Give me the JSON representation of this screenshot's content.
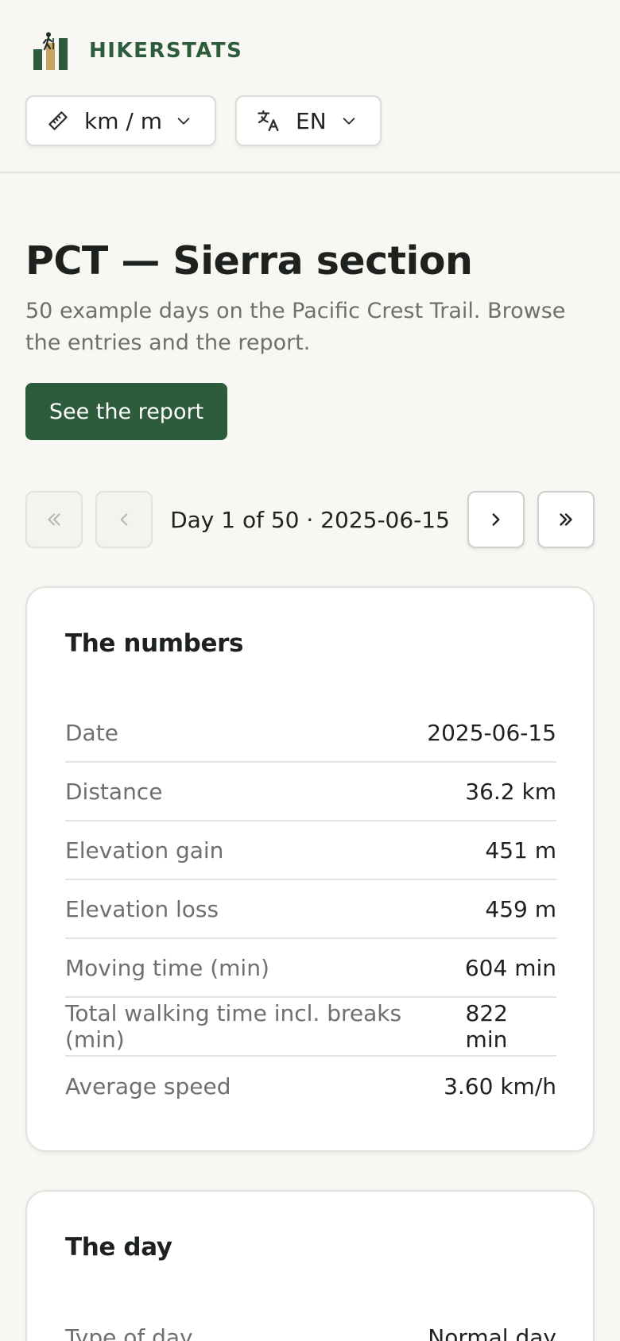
{
  "header": {
    "brand_name": "HIKERSTATS",
    "units_select": {
      "icon": "ruler-icon",
      "value": "km / m"
    },
    "language_select": {
      "icon": "translate-icon",
      "value": "EN"
    }
  },
  "hero": {
    "title": "PCT — Sierra section",
    "subtitle": "50 example days on the Pacific Crest Trail. Browse the entries and the report.",
    "report_button": "See the report"
  },
  "pager": {
    "indicator": "Day 1 of 50 · 2025-06-15",
    "first_icon": "double-chevron-left-icon",
    "prev_icon": "chevron-left-icon",
    "next_icon": "chevron-right-icon",
    "last_icon": "double-chevron-right-icon"
  },
  "numbers_card": {
    "title": "The numbers",
    "rows": [
      {
        "label": "Date",
        "value": "2025-06-15"
      },
      {
        "label": "Distance",
        "value": "36.2 km"
      },
      {
        "label": "Elevation gain",
        "value": "451 m"
      },
      {
        "label": "Elevation loss",
        "value": "459 m"
      },
      {
        "label": "Moving time (min)",
        "value": "604 min"
      },
      {
        "label": "Total walking time incl. breaks (min)",
        "value": "822 min"
      },
      {
        "label": "Average speed",
        "value": "3.60 km/h"
      }
    ]
  },
  "day_card": {
    "title": "The day",
    "rows": [
      {
        "label": "Type of day",
        "value": "Normal day"
      }
    ]
  },
  "colors": {
    "brand": "#2c5c3c",
    "logo_accent": "#c9a560",
    "background": "#f8f7f4"
  }
}
